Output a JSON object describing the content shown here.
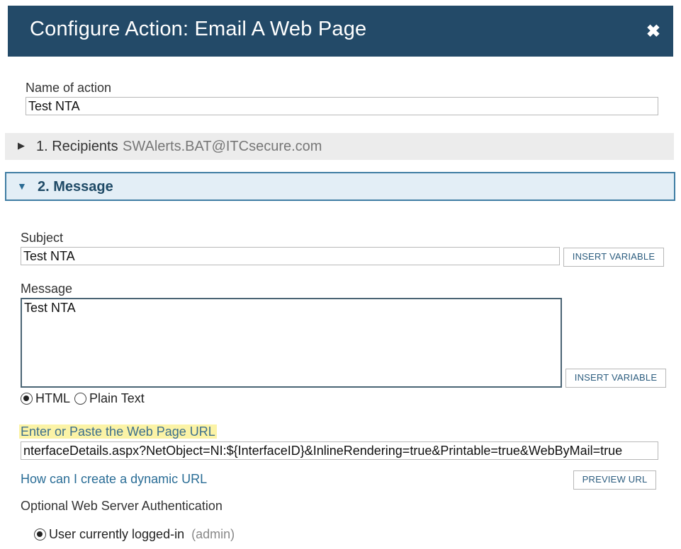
{
  "dialog": {
    "title": "Configure Action: Email A Web Page",
    "close_icon": "close-icon"
  },
  "name_of_action": {
    "label": "Name of action",
    "value": "Test NTA"
  },
  "sections": {
    "recipients": {
      "label": "1. Recipients",
      "summary": "SWAlerts.BAT@ITCsecure.com",
      "expanded": false
    },
    "message": {
      "label": "2. Message",
      "expanded": true
    }
  },
  "subject": {
    "label": "Subject",
    "value": "Test NTA",
    "insert_variable": "INSERT VARIABLE"
  },
  "message": {
    "label": "Message",
    "value": "Test NTA",
    "insert_variable": "INSERT VARIABLE"
  },
  "format": {
    "options": [
      "HTML",
      "Plain Text"
    ],
    "selected": "HTML"
  },
  "url": {
    "label": "Enter or Paste the Web Page URL",
    "value": "nterfaceDetails.aspx?NetObject=NI:${InterfaceID}&InlineRendering=true&Printable=true&WebByMail=true",
    "help_link": "How can I create a dynamic URL",
    "preview_button": "PREVIEW URL"
  },
  "auth": {
    "label": "Optional Web Server Authentication",
    "option_label": "User currently logged-in",
    "option_user": "(admin)",
    "selected": true
  }
}
